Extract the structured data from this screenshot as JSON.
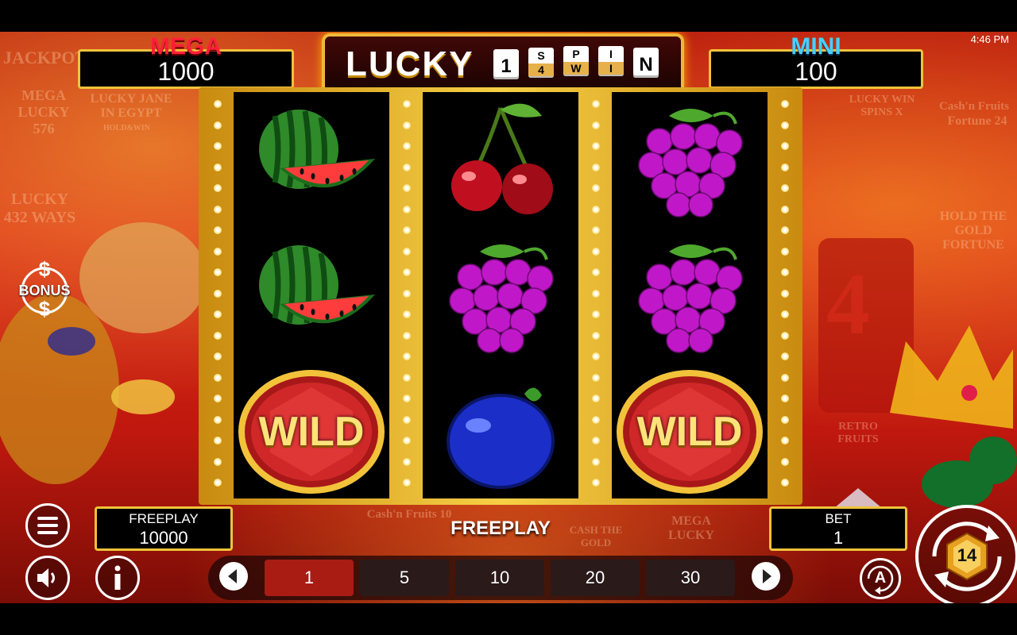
{
  "status_bar": {
    "time": "4:46 PM"
  },
  "jackpots": {
    "mega": {
      "title": "MEGA",
      "value": "1000"
    },
    "mini": {
      "title": "MINI",
      "value": "100"
    }
  },
  "logo": {
    "word": "LUCKY",
    "tiles": [
      {
        "type": "big",
        "text": "1"
      },
      {
        "type": "split",
        "top": "S",
        "bottom": "4"
      },
      {
        "type": "split",
        "top": "P",
        "bottom": "W"
      },
      {
        "type": "split",
        "top": "I",
        "bottom": "I"
      },
      {
        "type": "big",
        "text": "N"
      }
    ]
  },
  "background_titles": [
    "JACKPOT",
    "MEGA LUCKY 576",
    "LUCKY JANE IN EGYPT",
    "HOLD&WIN",
    "LUCKY 432 WAYS",
    "LUCKY WIN SPINS X",
    "Cash'n Fruits",
    "Fortune 24",
    "HOLD THE GOLD FORTUNE",
    "RETRO FRUITS",
    "Cash'n Fruits 10",
    "CASH THE GOLD",
    "MEGA LUCKY"
  ],
  "reels": [
    [
      "watermelon",
      "watermelon",
      "wild"
    ],
    [
      "cherry",
      "grapes",
      "plum"
    ],
    [
      "grapes",
      "grapes",
      "wild"
    ]
  ],
  "wild_label": "WILD",
  "bonus_label": "BONUS",
  "freeplay_box": {
    "label": "FREEPLAY",
    "value": "10000"
  },
  "freeplay_center": "FREEPLAY",
  "bet_box": {
    "label": "BET",
    "value": "1"
  },
  "bet_options": [
    "1",
    "5",
    "10",
    "20",
    "30"
  ],
  "selected_bet": "1",
  "autoplay_label": "A",
  "spin_logo": "14",
  "colors": {
    "mega": "#e8132a",
    "mini": "#39c6ff",
    "gold": "#f0c33a",
    "active_bet": "#a81c14"
  },
  "icons": [
    "menu-icon",
    "sound-icon",
    "info-icon",
    "bonus-dollar-icon",
    "left-arrow-icon",
    "right-arrow-icon",
    "autoplay-icon",
    "spin-icon"
  ]
}
